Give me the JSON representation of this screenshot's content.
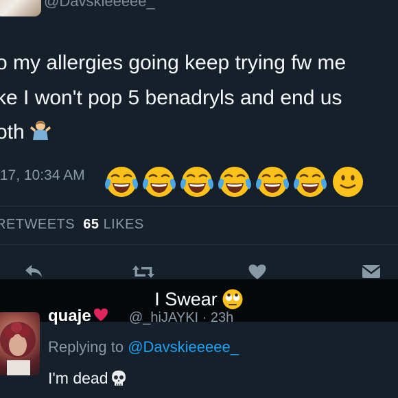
{
  "author": {
    "handle": "@Davskieeeee_"
  },
  "tweet": {
    "lines": [
      "o my allergies going keep trying fw me",
      "ke I won't pop 5 benadryls and end us",
      "oth"
    ],
    "timestamp": "/17, 10:34 AM",
    "reaction_emojis": [
      "face-with-tears-of-joy-icon",
      "face-with-tears-of-joy-icon",
      "face-with-tears-of-joy-icon",
      "face-with-tears-of-joy-icon",
      "face-with-tears-of-joy-icon",
      "face-with-tears-of-joy-icon",
      "slightly-smiling-face-icon"
    ]
  },
  "stats": {
    "retweets_label": "RETWEETS",
    "likes_count": "65",
    "likes_label": "LIKES"
  },
  "actions": [
    "reply-icon",
    "retweet-icon",
    "heart-icon",
    "dm-icon"
  ],
  "caption": {
    "text": "I Swear"
  },
  "reply": {
    "name": "quaje",
    "handle_time": "@_hiJAYKI · 23h",
    "replying_prefix": "Replying to",
    "replying_to": "@Davskieeeee_",
    "text": "I'm dead"
  },
  "colors": {
    "background": "#16202b",
    "muted_text": "#8899a6",
    "link_blue": "#1da1f2",
    "heart_red": "#e0245e"
  }
}
